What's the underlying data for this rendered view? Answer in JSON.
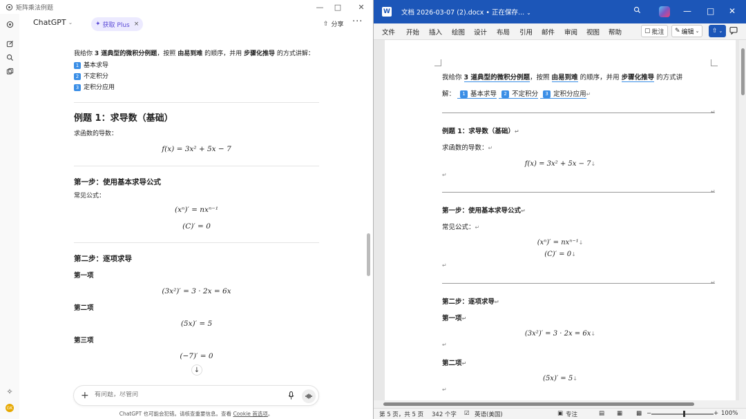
{
  "chat": {
    "window_title": "矩阵乘法例题",
    "model": "ChatGPT",
    "plus_button": "获取 Plus",
    "share": "分享",
    "intro_parts": [
      "我给你",
      "3 道典型的微积分例题",
      "，按照",
      "由易到难",
      "的顺序，并用",
      "步骤化推导",
      "的方式讲解："
    ],
    "list_items": [
      {
        "num": "1",
        "text": "基本求导"
      },
      {
        "num": "2",
        "text": "不定积分"
      },
      {
        "num": "3",
        "text": "定积分应用"
      }
    ],
    "example1_title": "例题 1：求导数（基础）",
    "example1_desc": "求函数的导数：",
    "example1_eq": "f(x) = 3x² + 5x − 7",
    "step1_title": "第一步：使用基本求导公式",
    "step1_desc": "常见公式：",
    "step1_eq1": "(xⁿ)′ = nxⁿ⁻¹",
    "step1_eq2": "(C)′ = 0",
    "step2_title": "第二步：逐项求导",
    "term1_title": "第一项",
    "term1_eq": "(3x²)′ = 3 · 2x = 6x",
    "term2_title": "第二项",
    "term2_eq": "(5x)′ = 5",
    "term3_title": "第三项",
    "term3_eq": "(−7)′ = 0",
    "composer_placeholder": "有问题，尽管问",
    "footer_note": "ChatGPT 也可能会犯错。请核查重要信息。查看",
    "footer_link": "Cookie 首选项",
    "footer_end": "。",
    "avatar_initials": "GK"
  },
  "word": {
    "doc_title": "文档 2026-03-07 (2).docx • 正在保存...",
    "tabs": [
      "文件",
      "开始",
      "插入",
      "绘图",
      "设计",
      "布局",
      "引用",
      "邮件",
      "审阅",
      "视图",
      "帮助"
    ],
    "comment_btn": "批注",
    "edit_btn": "编辑",
    "intro_parts": [
      "我给你",
      "3 道典型的微积分例题",
      "，按照",
      "由易到难",
      "的顺序，并用",
      "步骤化推导",
      "的方式讲"
    ],
    "intro_line2_start": "解：",
    "list_items": [
      "基本求导",
      "不定积分",
      "定积分应用"
    ],
    "list_nums": [
      "1",
      "2",
      "3"
    ],
    "example1_title": "例题 1：求导数（基础）",
    "example1_desc": "求函数的导数：",
    "example1_eq": "f(x) = 3x² + 5x − 7",
    "step1_title": "第一步：使用基本求导公式",
    "step1_desc": "常见公式：",
    "step1_eq1": "(xⁿ)′ = nxⁿ⁻¹",
    "step1_eq2": "(C)′ = 0",
    "step2_title": "第二步：逐项求导",
    "term1_title": "第一项",
    "term1_eq": "(3x²)′ = 3 · 2x = 6x",
    "term2_title": "第二项",
    "term2_eq": "(5x)′ = 5",
    "status_page": "第 5 页，共 5 页",
    "status_words": "342 个字",
    "status_lang": "英语(美国)",
    "status_focus": "专注",
    "status_zoom": "100%"
  }
}
